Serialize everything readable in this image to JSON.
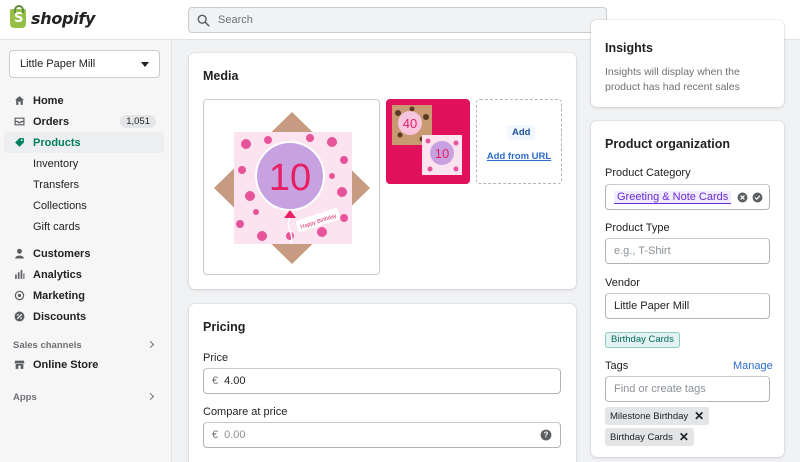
{
  "brand": {
    "name": "shopify",
    "bag_letter": "S"
  },
  "search": {
    "placeholder": "Search"
  },
  "sidebar": {
    "store_name": "Little Paper Mill",
    "nav": {
      "home": "Home",
      "orders": "Orders",
      "orders_count": "1,051",
      "products": "Products",
      "inventory": "Inventory",
      "transfers": "Transfers",
      "collections": "Collections",
      "gift_cards": "Gift cards",
      "customers": "Customers",
      "analytics": "Analytics",
      "marketing": "Marketing",
      "discounts": "Discounts"
    },
    "sales_channels_label": "Sales channels",
    "online_store": "Online Store",
    "apps_label": "Apps"
  },
  "media": {
    "title": "Media",
    "main_image_number": "10",
    "main_image_tag": "Happy Birthday",
    "thumb_numbers": [
      "40",
      "10"
    ],
    "add_label": "Add",
    "add_from_url": "Add from URL"
  },
  "pricing": {
    "title": "Pricing",
    "price_label": "Price",
    "currency_symbol": "€",
    "price_value": "4.00",
    "compare_label": "Compare at price",
    "compare_placeholder": "0.00"
  },
  "insights": {
    "title": "Insights",
    "text": "Insights will display when the product has had recent sales"
  },
  "organization": {
    "title": "Product organization",
    "category_label": "Product Category",
    "category_value": "Greeting & Note Cards",
    "type_label": "Product Type",
    "type_placeholder": "e.g., T-Shirt",
    "vendor_label": "Vendor",
    "vendor_value": "Little Paper Mill",
    "collection_chip": "Birthday Cards",
    "tags_label": "Tags",
    "manage_label": "Manage",
    "tags_placeholder": "Find or create tags",
    "tags": [
      "Milestone Birthday",
      "Birthday Cards"
    ]
  },
  "colors": {
    "accent_green": "#008060",
    "link_blue": "#2c6ecb",
    "pink": "#e91e63",
    "brand_green": "#95bf47"
  }
}
